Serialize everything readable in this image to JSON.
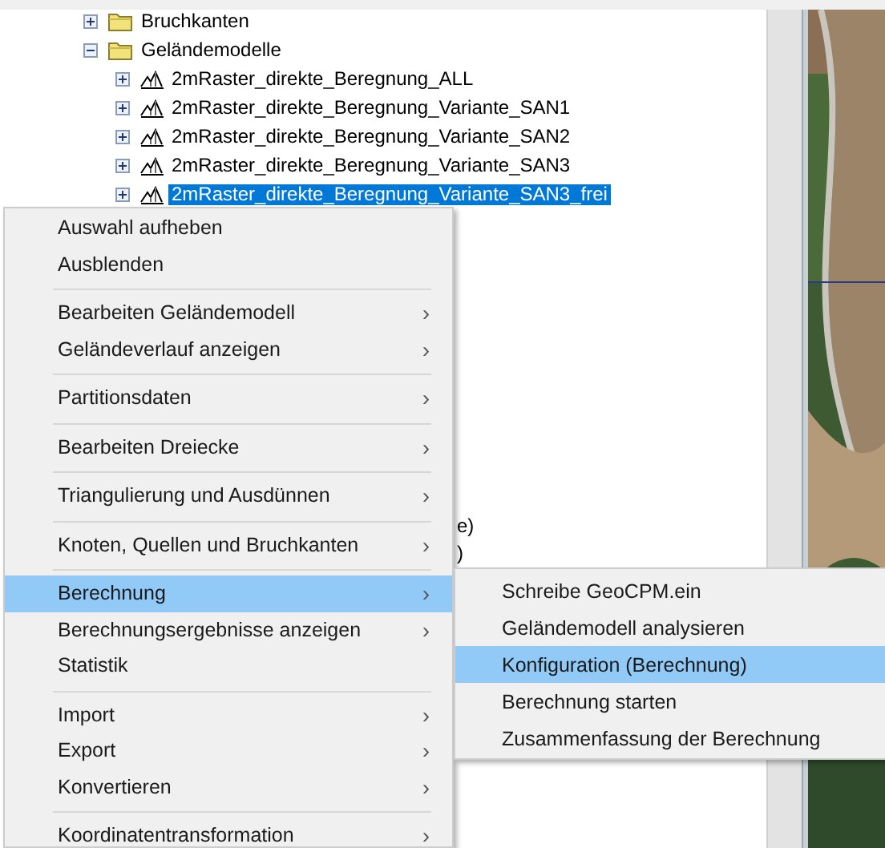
{
  "tree": {
    "items": [
      {
        "label": "Bruchkanten",
        "kind": "folder",
        "expanded": false,
        "selected": false
      },
      {
        "label": "Geländemodelle",
        "kind": "folder",
        "expanded": true,
        "selected": false,
        "children": [
          {
            "label": "2mRaster_direkte_Beregnung_ALL",
            "kind": "terrain",
            "expanded": false,
            "selected": false
          },
          {
            "label": "2mRaster_direkte_Beregnung_Variante_SAN1",
            "kind": "terrain",
            "expanded": false,
            "selected": false
          },
          {
            "label": "2mRaster_direkte_Beregnung_Variante_SAN2",
            "kind": "terrain",
            "expanded": false,
            "selected": false
          },
          {
            "label": "2mRaster_direkte_Beregnung_Variante_SAN3",
            "kind": "terrain",
            "expanded": false,
            "selected": false
          },
          {
            "label": "2mRaster_direkte_Beregnung_Variante_SAN3_frei",
            "kind": "terrain",
            "expanded": false,
            "selected": true
          }
        ]
      }
    ],
    "fragments": [
      "e)",
      ")"
    ]
  },
  "context_menu": {
    "groups": [
      [
        {
          "label": "Auswahl aufheben",
          "submenu": false,
          "selected": false
        },
        {
          "label": "Ausblenden",
          "submenu": false,
          "selected": false
        }
      ],
      [
        {
          "label": "Bearbeiten Geländemodell",
          "submenu": true,
          "selected": false
        },
        {
          "label": "Geländeverlauf anzeigen",
          "submenu": true,
          "selected": false
        }
      ],
      [
        {
          "label": "Partitionsdaten",
          "submenu": true,
          "selected": false
        }
      ],
      [
        {
          "label": "Bearbeiten Dreiecke",
          "submenu": true,
          "selected": false
        }
      ],
      [
        {
          "label": "Triangulierung und Ausdünnen",
          "submenu": true,
          "selected": false
        }
      ],
      [
        {
          "label": "Knoten, Quellen und Bruchkanten",
          "submenu": true,
          "selected": false
        }
      ],
      [
        {
          "label": "Berechnung",
          "submenu": true,
          "selected": true
        },
        {
          "label": "Berechnungsergebnisse anzeigen",
          "submenu": true,
          "selected": false
        },
        {
          "label": "Statistik",
          "submenu": false,
          "selected": false
        }
      ],
      [
        {
          "label": "Import",
          "submenu": true,
          "selected": false
        },
        {
          "label": "Export",
          "submenu": true,
          "selected": false
        },
        {
          "label": "Konvertieren",
          "submenu": true,
          "selected": false
        }
      ],
      [
        {
          "label": "Koordinatentransformation",
          "submenu": true,
          "selected": false
        }
      ]
    ],
    "arrow": "›"
  },
  "submenu": {
    "items": [
      {
        "label": "Schreibe GeoCPM.ein",
        "selected": false
      },
      {
        "label": "Geländemodell analysieren",
        "selected": false
      },
      {
        "label": "Konfiguration (Berechnung)",
        "selected": true
      },
      {
        "label": "Berechnung starten",
        "selected": false
      },
      {
        "label": "Zusammenfassung der Berechnung",
        "selected": false
      }
    ]
  }
}
